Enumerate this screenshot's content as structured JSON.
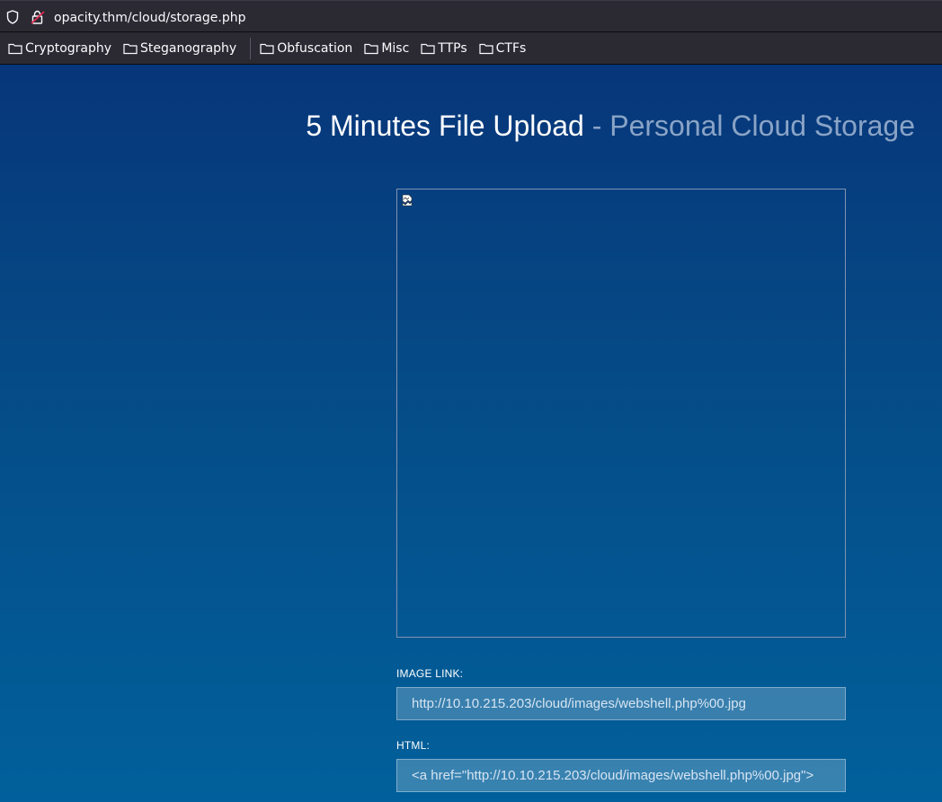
{
  "browser": {
    "url": "opacity.thm/cloud/storage.php",
    "bookmarks": [
      "Cryptography",
      "Steganography",
      "Obfuscation",
      "Misc",
      "TTPs",
      "CTFs"
    ]
  },
  "page": {
    "title_main": "5 Minutes File Upload",
    "title_sub": "- Personal Cloud Storage",
    "image_link_label": "IMAGE LINK:",
    "image_link_value": "http://10.10.215.203/cloud/images/webshell.php%00.jpg",
    "html_label": "HTML:",
    "html_value": "<a href=\"http://10.10.215.203/cloud/images/webshell.php%00.jpg\">"
  },
  "colors": {
    "chrome": "#2b2a33",
    "page_top": "#07367a",
    "page_bottom": "#01609b"
  }
}
